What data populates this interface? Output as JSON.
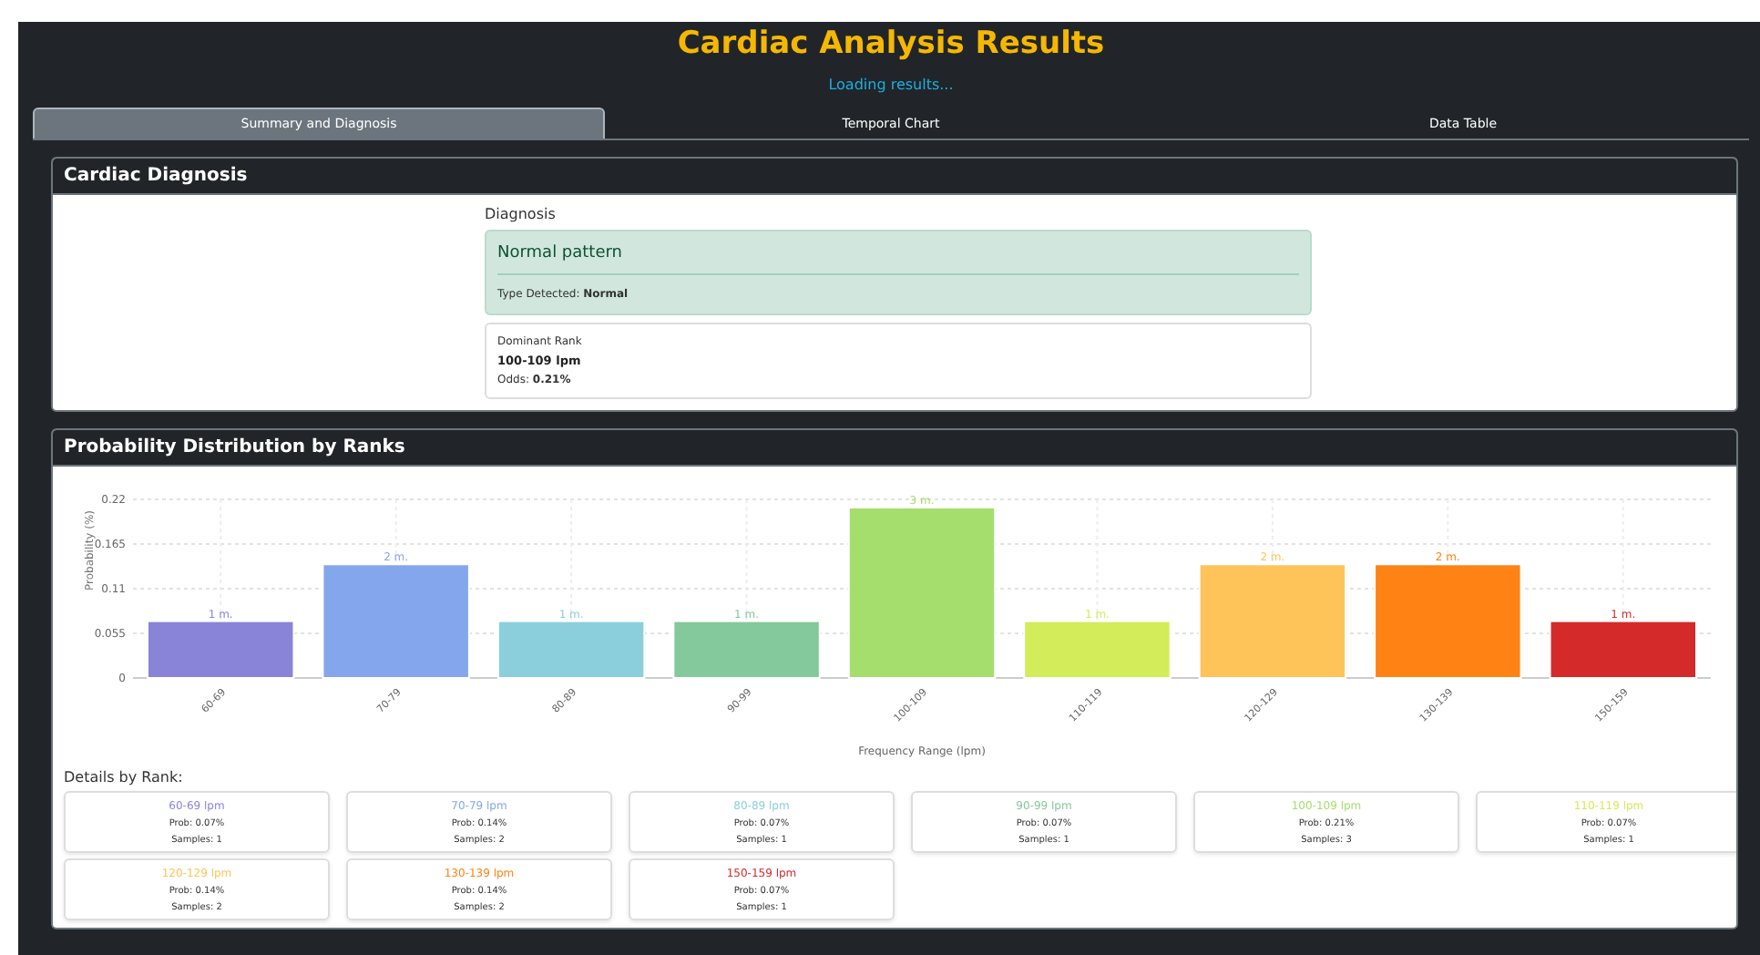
{
  "title": "Cardiac Analysis Results",
  "status": "Loading results...",
  "tabs": [
    {
      "label": "Summary and Diagnosis",
      "selected": true
    },
    {
      "label": "Temporal Chart",
      "selected": false
    },
    {
      "label": "Data Table",
      "selected": false
    }
  ],
  "diagnosis_card": {
    "title": "Cardiac Diagnosis",
    "section_label": "Diagnosis",
    "result": "Normal pattern",
    "type_text": "Type Detected: **Normal**",
    "dominant_label": "Dominant Rank",
    "dominant_value": "100-109 lpm",
    "odds_text": "Odds: **0.21%**"
  },
  "distribution_card": {
    "title": "Probability Distribution by Ranks",
    "chart_data": {
      "type": "bar",
      "xlabel": "Frequency Range (lpm)",
      "ylabel": "Probability (%)",
      "categories": [
        "60-69",
        "70-79",
        "80-89",
        "90-99",
        "100-109",
        "110-119",
        "120-129",
        "130-139",
        "150-159"
      ],
      "values": [
        0.07,
        0.14,
        0.07,
        0.07,
        0.21,
        0.07,
        0.14,
        0.14,
        0.07
      ],
      "grid": true,
      "colors": [
        "#8a84d8",
        "#84a6ec",
        "#8ccfdc",
        "#84c99b",
        "#a6de6e",
        "#d2ec5a",
        "#fec45a",
        "#fe8214",
        "#d42a2a"
      ],
      "annotations": [
        {
          "x": "60-69",
          "text": "1 m."
        },
        {
          "x": "70-79",
          "text": "2 m."
        },
        {
          "x": "80-89",
          "text": "1 m."
        },
        {
          "x": "90-99",
          "text": "1 m."
        },
        {
          "x": "100-109",
          "text": "3 m."
        },
        {
          "x": "110-119",
          "text": "1 m."
        },
        {
          "x": "120-129",
          "text": "2 m."
        },
        {
          "x": "130-139",
          "text": "2 m."
        },
        {
          "x": "150-159",
          "text": "1 m."
        }
      ],
      "ylim": [
        0,
        0.22
      ],
      "yticks": [
        0,
        0.055,
        0.11,
        0.165,
        0.22
      ]
    },
    "details_title": "Details by Rank:",
    "details": [
      {
        "range": "60-69 lpm",
        "prob": "Prob: 0.07%",
        "samples": "Samples: 1",
        "color": "#8a84d8"
      },
      {
        "range": "70-79 lpm",
        "prob": "Prob: 0.14%",
        "samples": "Samples: 2",
        "color": "#84a6ec"
      },
      {
        "range": "80-89 lpm",
        "prob": "Prob: 0.07%",
        "samples": "Samples: 1",
        "color": "#8ccfdc"
      },
      {
        "range": "90-99 lpm",
        "prob": "Prob: 0.07%",
        "samples": "Samples: 1",
        "color": "#84c99b"
      },
      {
        "range": "100-109 lpm",
        "prob": "Prob: 0.21%",
        "samples": "Samples: 3",
        "color": "#a6de6e"
      },
      {
        "range": "110-119 lpm",
        "prob": "Prob: 0.07%",
        "samples": "Samples: 1",
        "color": "#d2ec5a"
      },
      {
        "range": "120-129 lpm",
        "prob": "Prob: 0.14%",
        "samples": "Samples: 2",
        "color": "#fec45a"
      },
      {
        "range": "130-139 lpm",
        "prob": "Prob: 0.14%",
        "samples": "Samples: 2",
        "color": "#fe8214"
      },
      {
        "range": "150-159 lpm",
        "prob": "Prob: 0.07%",
        "samples": "Samples: 1",
        "color": "#d42a2a"
      }
    ]
  }
}
